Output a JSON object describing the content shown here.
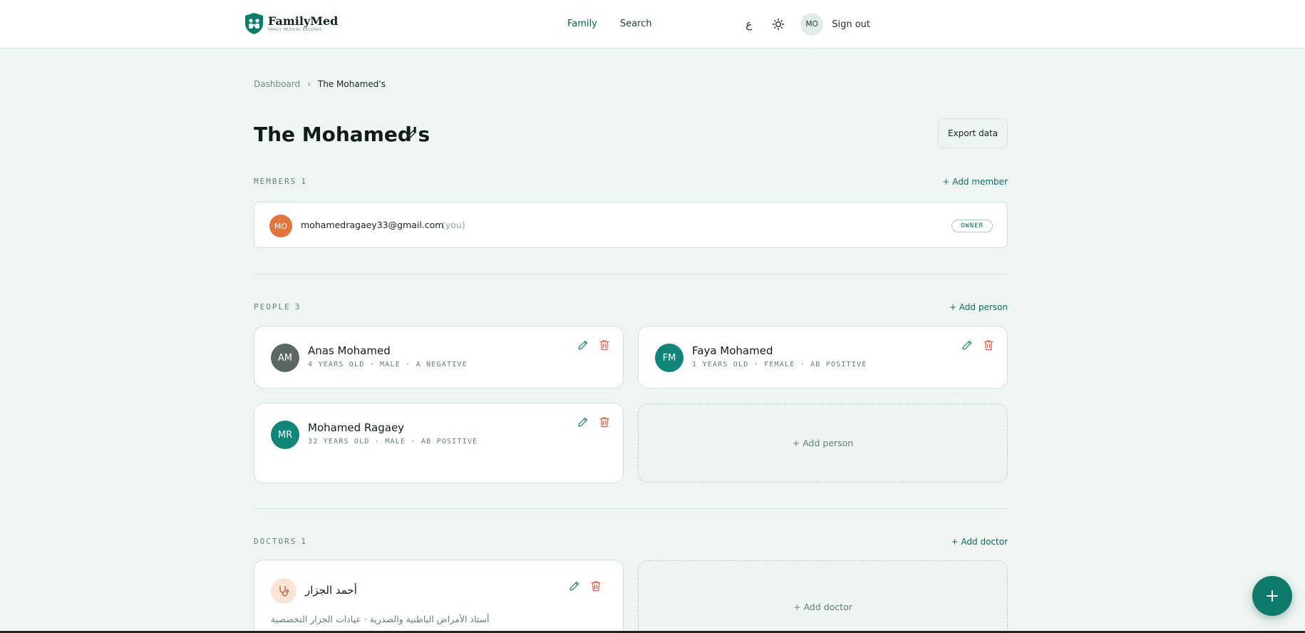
{
  "header": {
    "brand_name": "FamilyMed",
    "brand_tagline": "FAMILY MEDICAL RECORDS",
    "nav": [
      "Family",
      "Search"
    ],
    "language_toggle": "ع",
    "theme_icon": "sun-icon",
    "user_initials": "MO",
    "sign_out": "Sign out"
  },
  "breadcrumb": {
    "parent": "Dashboard",
    "current": "The Mohamed's"
  },
  "page": {
    "title": "The Mohamed's",
    "export_label": "Export data"
  },
  "members": {
    "heading": "MEMBERS",
    "count": "1",
    "add_label": "+ Add member",
    "items": [
      {
        "initials": "MO",
        "email": "mohamedragaey33@gmail.com",
        "you_label": "(you)",
        "role": "OWNER",
        "avatar_color": "#e0753f"
      }
    ]
  },
  "people": {
    "heading": "PEOPLE",
    "count": "3",
    "add_label": "+ Add person",
    "add_card_label": "+ Add person",
    "items": [
      {
        "initials": "AM",
        "name": "Anas Mohamed",
        "meta": "4 YEARS OLD · MALE · A NEGATIVE",
        "avatar_color": "#5a6764"
      },
      {
        "initials": "FM",
        "name": "Faya Mohamed",
        "meta": "1 YEARS OLD · FEMALE · AB POSITIVE",
        "avatar_color": "#12857a"
      },
      {
        "initials": "MR",
        "name": "Mohamed Ragaey",
        "meta": "32 YEARS OLD · MALE · AB POSITIVE",
        "avatar_color": "#12857a"
      }
    ]
  },
  "doctors": {
    "heading": "DOCTORS",
    "count": "1",
    "add_label": "+ Add doctor",
    "add_card_label": "+ Add doctor",
    "items": [
      {
        "name": "أحمد الجزار",
        "specialty": "أستاذ الأمراض الباطنية والصدرية · عيادات الجزار التخصصية",
        "icon": "stethoscope-icon"
      }
    ]
  },
  "fab": {
    "icon": "plus-icon"
  },
  "colors": {
    "accent": "#0e7a6a",
    "background": "#eff5f2",
    "danger": "#e0624a"
  }
}
